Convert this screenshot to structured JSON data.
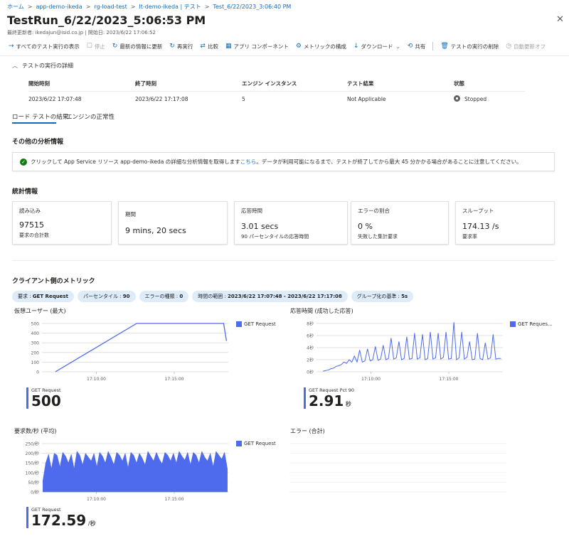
{
  "breadcrumb": [
    "ホーム",
    "app-demo-ikeda",
    "rg-load-test",
    "lt-demo-ikeda | テスト",
    "Test_6/22/2023_3:06:40 PM"
  ],
  "header": {
    "title": "TestRun_6/22/2023_5:06:53 PM",
    "more": "···",
    "close": "✕",
    "subtitle": "最終更新者: ikedajun@isid.co.jp | 開始日: 2023/6/22 17:06:52"
  },
  "toolbar": {
    "all_runs": "すべてのテスト実行の表示",
    "stop": "停止",
    "refresh": "最新の情報に更新",
    "rerun": "再実行",
    "compare": "比較",
    "app_components": "アプリ コンポーネント",
    "metrics_config": "メトリックの構成",
    "download": "ダウンロード",
    "share": "共有",
    "delete": "テストの実行の削除",
    "auto_refresh_off": "自動更新オフ"
  },
  "details": {
    "heading": "テストの実行の詳細",
    "headers": [
      "開始時刻",
      "終了時刻",
      "エンジン インスタンス",
      "テスト結果",
      "状態"
    ],
    "row": [
      "2023/6/22 17:07:48",
      "2023/6/22 17:17:08",
      "5",
      "Not Applicable",
      "Stopped"
    ]
  },
  "tabs": [
    "ロード テストの結果",
    "エンジンの正常性"
  ],
  "analysis": {
    "heading": "その他の分析情報",
    "text_before": "クリックして App Service リソース app-demo-ikeda の詳細な分析情報を取得します ",
    "link": "こちら",
    "text_after": "。データが利用可能になるまで、テストが終了してから最大 45 分かかる場合があることに注意してください。"
  },
  "stats": {
    "heading": "統計情報",
    "cards": [
      {
        "title": "読み込み",
        "value": "97515",
        "sub": "要求の合計数"
      },
      {
        "title": "期間",
        "value": "9 mins, 20 secs",
        "sub": ""
      },
      {
        "title": "応答時間",
        "value": "3.01 secs",
        "sub": "90 パーセンタイルの応答時間"
      },
      {
        "title": "エラーの割合",
        "value": "0 %",
        "sub": "失敗した集計要求"
      },
      {
        "title": "スループット",
        "value": "174.13 /s",
        "sub": "要求率"
      }
    ]
  },
  "client_metrics": {
    "heading": "クライアント側のメトリック",
    "pill_request": {
      "label": "要求 : ",
      "value": "GET Request"
    },
    "pill_percentile": {
      "label": "パーセンタイル : ",
      "value": "90"
    },
    "pill_error": {
      "label": "エラーの種類 : ",
      "value": "0"
    },
    "pill_range": {
      "label": "時間の範囲 : ",
      "value": "2023/6/22 17:07:48 - 2023/6/22 17:17:08"
    },
    "pill_group": {
      "label": "グループ化の基準 : ",
      "value": "5s"
    }
  },
  "charts": {
    "vusers": {
      "title": "仮想ユーザー (最大)",
      "legend": "GET Request",
      "stat_label": "GET Request",
      "stat_value": "500",
      "stat_unit": ""
    },
    "response": {
      "title": "応答時間 (成功した応答)",
      "legend": "GET Reques...",
      "stat_label": "GET Request Pct 90",
      "stat_value": "2.91",
      "stat_unit": "秒"
    },
    "rps": {
      "title": "要求数/秒 (平均)",
      "legend": "GET Request",
      "stat_label": "GET Request",
      "stat_value": "172.59",
      "stat_unit": "/秒"
    },
    "errors": {
      "title": "エラー (合計)"
    }
  },
  "colors": {
    "accent": "#0f6cbd",
    "series": "#4f6bed",
    "ok": "#107c10"
  },
  "chart_data": [
    {
      "type": "line",
      "title": "仮想ユーザー (最大)",
      "series": [
        {
          "name": "GET Request",
          "x": [
            "17:07:48",
            "17:12:00",
            "17:16:58",
            "17:17:08"
          ],
          "values": [
            0,
            500,
            500,
            320
          ]
        }
      ],
      "yticks": [
        "0",
        "100",
        "200",
        "300",
        "400",
        "500"
      ],
      "xticks": [
        "17:10:00",
        "17:15:00"
      ],
      "ylim": [
        0,
        500
      ]
    },
    {
      "type": "line",
      "title": "応答時間 (成功した応答)",
      "series": [
        {
          "name": "GET Request",
          "values": [
            0.1,
            0.2,
            0.3,
            0.5,
            0.6,
            0.9,
            1.0,
            1.2,
            1.6,
            1.4,
            2.0,
            1.6,
            2.6,
            1.6,
            3.6,
            1.6,
            1.8,
            3.8,
            1.8,
            2.0,
            4.2,
            1.9,
            2.1,
            4.4,
            2.0,
            2.2,
            5.6,
            2.1,
            2.3,
            5.0,
            2.0,
            2.2,
            5.8,
            2.1,
            2.2,
            6.4,
            2.1,
            2.3,
            6.2,
            2.0,
            2.2,
            6.6,
            2.1,
            2.3,
            6.4,
            2.1,
            2.4,
            6.6,
            2.1,
            2.2,
            8.2,
            2.0,
            2.3,
            6.6,
            2.1,
            2.4,
            5.0,
            2.0,
            2.1,
            6.4,
            2.2,
            2.0,
            4.8,
            2.1,
            2.3,
            6.2,
            2.1,
            2.2,
            2.2
          ]
        }
      ],
      "yticks": [
        "0秒",
        "2秒",
        "4秒",
        "6秒",
        "8秒"
      ],
      "xticks": [
        "17:10:00",
        "17:15:00"
      ],
      "ylim": [
        0,
        8
      ]
    },
    {
      "type": "area",
      "title": "要求数/秒 (平均)",
      "series": [
        {
          "name": "GET Request",
          "values": [
            60,
            150,
            195,
            120,
            200,
            190,
            130,
            205,
            185,
            150,
            195,
            120,
            210,
            190,
            140,
            200,
            180,
            160,
            200,
            130,
            205,
            185,
            150,
            210,
            180,
            140,
            205,
            190,
            160,
            200,
            125,
            205,
            190,
            150,
            200,
            175,
            140,
            210,
            185,
            160,
            205,
            170,
            145,
            205,
            190,
            160,
            200,
            150,
            210,
            185,
            165,
            205,
            140,
            205,
            190,
            150,
            210,
            180,
            160,
            200,
            130,
            210,
            190,
            170,
            205,
            120
          ]
        }
      ],
      "yticks": [
        "0/秒",
        "50/秒",
        "100/秒",
        "150/秒",
        "200/秒",
        "250/秒"
      ],
      "xticks": [
        "17:10:00",
        "17:15:00"
      ],
      "ylim": [
        0,
        250
      ]
    }
  ]
}
